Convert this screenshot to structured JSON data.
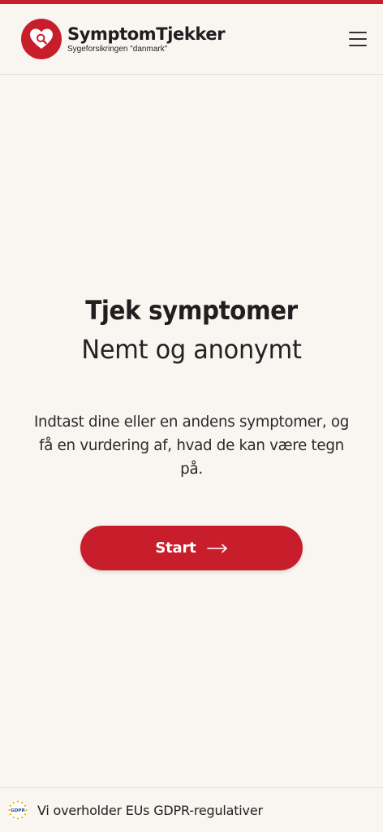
{
  "colors": {
    "brand_red": "#c81e2c",
    "background": "#f9f5f1",
    "text": "#222222"
  },
  "header": {
    "brand_name": "SymptomTjekker",
    "brand_sub": "Sygeforsikringen \"danmark\"",
    "logo_icon": "heart-magnifier-icon",
    "menu_icon": "hamburger-menu-icon"
  },
  "hero": {
    "title": "Tjek symptomer",
    "subtitle": "Nemt og anonymt",
    "description": "Indtast dine eller en andens symptomer, og få en vurdering af, hvad de kan være tegn på."
  },
  "start_button": {
    "label": "Start",
    "icon": "arrow-right-icon"
  },
  "footer": {
    "gdpr_badge_text": "GDPR",
    "text": "Vi overholder EUs GDPR-regulativer"
  }
}
